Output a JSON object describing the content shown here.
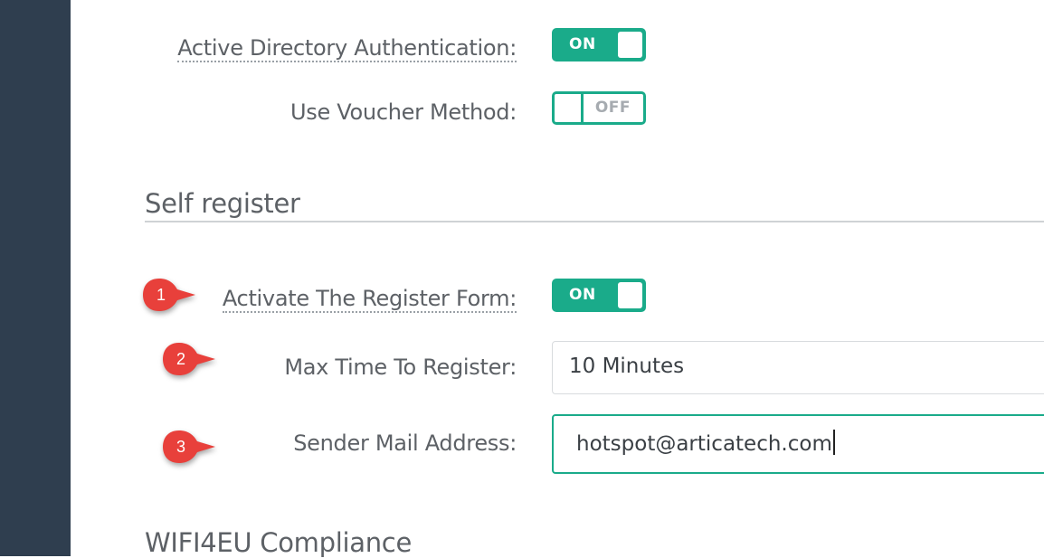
{
  "auth": {
    "ad_label": "Active Directory Authentication:",
    "ad_toggle": "ON",
    "voucher_label": "Use Voucher Method:",
    "voucher_toggle": "OFF"
  },
  "self_register": {
    "title": "Self register",
    "activate_label": "Activate The Register Form:",
    "activate_toggle": "ON",
    "max_time_label": "Max Time To Register:",
    "max_time_value": "10 Minutes",
    "sender_label": "Sender Mail Address:",
    "sender_value": "hotspot@articatech.com"
  },
  "wifi4eu": {
    "title": "WIFI4EU Compliance"
  },
  "markers": [
    "1",
    "2",
    "3"
  ],
  "colors": {
    "accent": "#1aab8a",
    "sidebar": "#2f3e4f",
    "marker": "#e8403b"
  }
}
